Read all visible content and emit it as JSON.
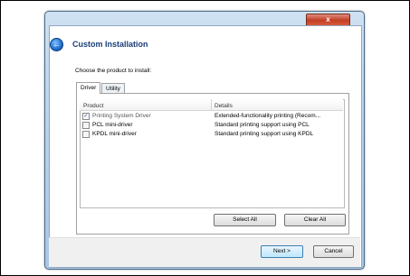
{
  "window": {
    "title": "Custom Installation",
    "close_label": "x",
    "back_label": "←"
  },
  "prompt": "Choose the product to install:",
  "tabs": [
    {
      "label": "Driver",
      "active": true
    },
    {
      "label": "Utility",
      "active": false
    }
  ],
  "table": {
    "columns": [
      "Product",
      "Details"
    ],
    "rows": [
      {
        "product": "Printing System Driver",
        "details": "Extended-functionality printing (Recom...",
        "checked": true
      },
      {
        "product": "PCL mini-driver",
        "details": "Standard printing support using PCL",
        "checked": false
      },
      {
        "product": "KPDL mini-driver",
        "details": "Standard printing support using KPDL",
        "checked": false
      }
    ]
  },
  "buttons": {
    "select_all": "Select All",
    "clear_all": "Clear All",
    "next": "Next >",
    "cancel": "Cancel"
  },
  "icons": {
    "back": "back-arrow-icon",
    "close": "close-icon",
    "checkbox_checked": "checkmark-icon"
  }
}
